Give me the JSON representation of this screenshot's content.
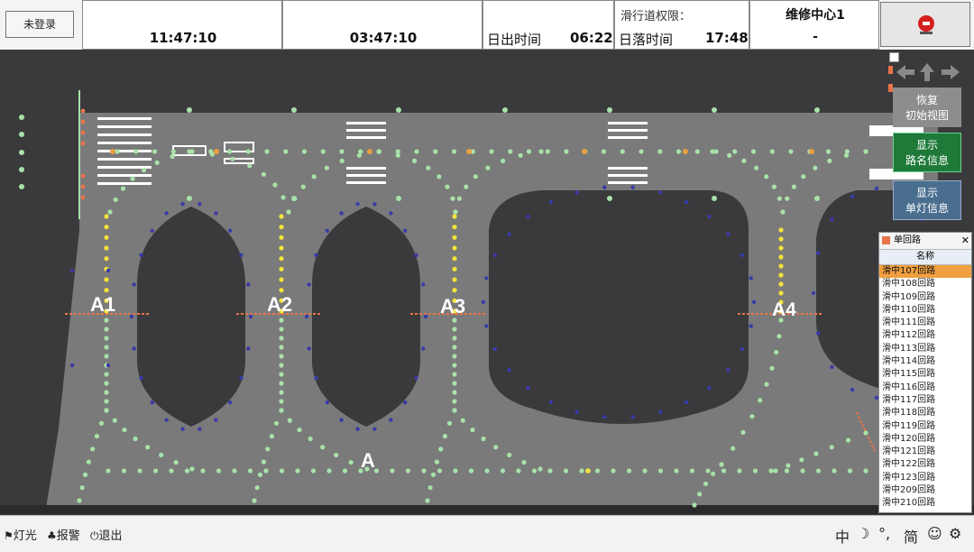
{
  "login_button": "未登录",
  "times": {
    "sunrise_label": "日出时间",
    "sunrise_value": "06:22",
    "sunset_label": "日落时间",
    "sunset_value": "17:48",
    "time_left": "11:47:10",
    "time_mid": "03:47:10"
  },
  "taxiway_permission_label": "滑行道权限：",
  "center": {
    "name": "维修中心1",
    "value": "-"
  },
  "side_buttons": {
    "restore_view": [
      "恢复",
      "初始视图"
    ],
    "show_circuit_names": [
      "显示",
      "路名信息"
    ],
    "show_lamp_info": [
      "显示",
      "单灯信息"
    ]
  },
  "map": {
    "labels": [
      "A1",
      "A2",
      "A3",
      "A4",
      "A"
    ]
  },
  "circuit_panel": {
    "title": "单回路",
    "column_header": "名称",
    "rows": [
      "滑中107回路",
      "滑中108回路",
      "滑中109回路",
      "滑中110回路",
      "滑中111回路",
      "滑中112回路",
      "滑中113回路",
      "滑中114回路",
      "滑中115回路",
      "滑中116回路",
      "滑中117回路",
      "滑中118回路",
      "滑中119回路",
      "滑中120回路",
      "滑中121回路",
      "滑中122回路",
      "滑中123回路",
      "滑中209回路",
      "滑中210回路"
    ],
    "selected_index": 0
  },
  "statusbar": {
    "lights": "灯光",
    "alarm": "报警",
    "exit": "退出",
    "ime_zh": "中",
    "ime_comma": "°,",
    "ime_simplified": "简"
  },
  "colors": {
    "apron": "#7a7a7a",
    "hole": "#3a3a3c",
    "lamp_green": "#a8e2a8",
    "lamp_yellow": "#f5e23a",
    "lamp_blue": "#3a3aa8",
    "highlight_button": "#1f7a3a",
    "selected_row": "#f0a040"
  }
}
